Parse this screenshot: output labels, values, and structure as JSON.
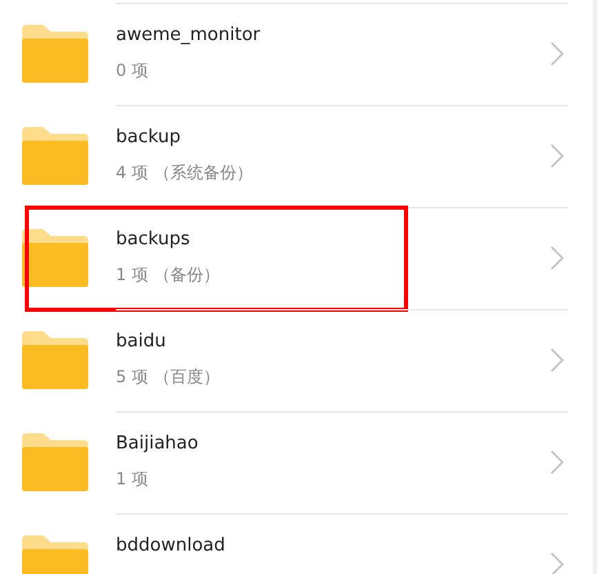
{
  "folders": [
    {
      "name": "aweme_monitor",
      "detail": "0 项",
      "highlighted": false
    },
    {
      "name": "backup",
      "detail": "4 项 （系统备份）",
      "highlighted": false
    },
    {
      "name": "backups",
      "detail": "1 项 （备份）",
      "highlighted": true
    },
    {
      "name": "baidu",
      "detail": "5 项 （百度）",
      "highlighted": false
    },
    {
      "name": "Baijiahao",
      "detail": "1 项",
      "highlighted": false
    },
    {
      "name": "bddownload",
      "highlighted": false
    }
  ]
}
